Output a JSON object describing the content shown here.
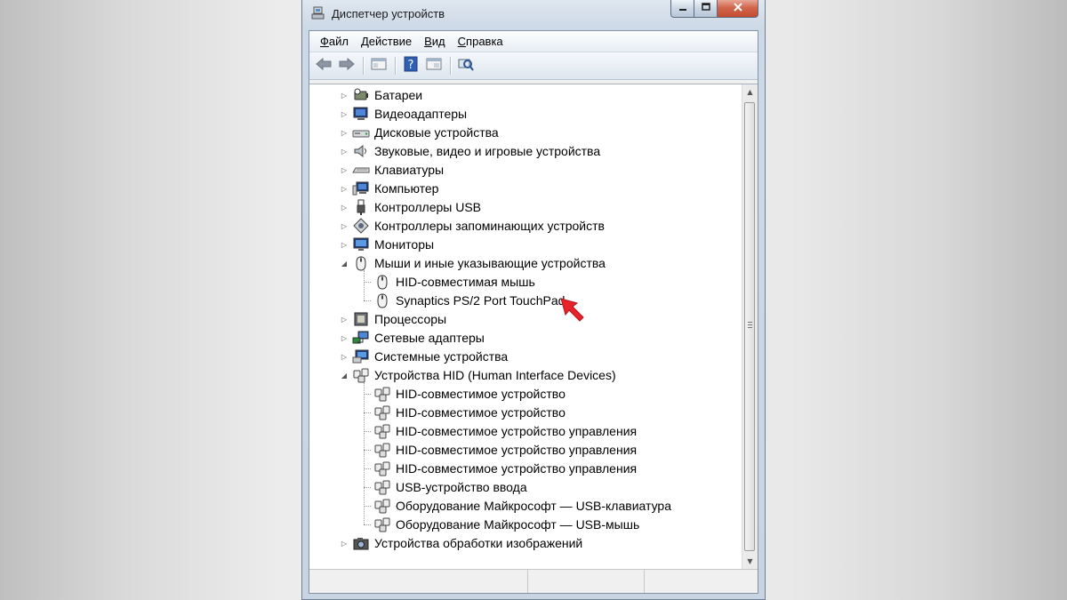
{
  "window": {
    "title": "Диспетчер устройств",
    "title_icon": "device-manager-icon",
    "controls": [
      "minimize-icon",
      "maximize-icon",
      "close-icon"
    ]
  },
  "menu": [
    {
      "label_underlined": "Ф",
      "label_rest": "айл"
    },
    {
      "label_underlined": "Д",
      "label_rest": "ействие"
    },
    {
      "label_underlined": "В",
      "label_rest": "ид"
    },
    {
      "label_underlined": "С",
      "label_rest": "правка"
    }
  ],
  "toolbar": {
    "icons": [
      "back-arrow-icon",
      "forward-arrow-icon",
      "properties-icon",
      "help-icon",
      "view-icon",
      "scan-hardware-icon"
    ]
  },
  "tree": {
    "categories": [
      {
        "label": "Батареи",
        "icon": "battery-icon",
        "expanded": false
      },
      {
        "label": "Видеоадаптеры",
        "icon": "display-adapter-icon",
        "expanded": false
      },
      {
        "label": "Дисковые устройства",
        "icon": "disk-drive-icon",
        "expanded": false
      },
      {
        "label": "Звуковые, видео и игровые устройства",
        "icon": "speaker-icon",
        "expanded": false
      },
      {
        "label": "Клавиатуры",
        "icon": "keyboard-icon",
        "expanded": false
      },
      {
        "label": "Компьютер",
        "icon": "computer-icon",
        "expanded": false
      },
      {
        "label": "Контроллеры USB",
        "icon": "usb-icon",
        "expanded": false
      },
      {
        "label": "Контроллеры запоминающих устройств",
        "icon": "storage-controller-icon",
        "expanded": false
      },
      {
        "label": "Мониторы",
        "icon": "monitor-icon",
        "expanded": false
      },
      {
        "label": "Мыши и иные указывающие устройства",
        "icon": "mouse-icon",
        "expanded": true,
        "children": [
          {
            "label": "HID-совместимая мышь",
            "icon": "mouse-icon"
          },
          {
            "label": "Synaptics PS/2 Port TouchPad",
            "icon": "mouse-icon"
          }
        ]
      },
      {
        "label": "Процессоры",
        "icon": "processor-icon",
        "expanded": false
      },
      {
        "label": "Сетевые адаптеры",
        "icon": "network-adapter-icon",
        "expanded": false
      },
      {
        "label": "Системные устройства",
        "icon": "system-device-icon",
        "expanded": false
      },
      {
        "label": "Устройства HID (Human Interface Devices)",
        "icon": "hid-device-icon",
        "expanded": true,
        "children": [
          {
            "label": "HID-совместимое устройство",
            "icon": "hid-device-icon"
          },
          {
            "label": "HID-совместимое устройство",
            "icon": "hid-device-icon"
          },
          {
            "label": "HID-совместимое устройство управления",
            "icon": "hid-device-icon"
          },
          {
            "label": "HID-совместимое устройство управления",
            "icon": "hid-device-icon"
          },
          {
            "label": "HID-совместимое устройство управления",
            "icon": "hid-device-icon"
          },
          {
            "label": "USB-устройство ввода",
            "icon": "hid-device-icon"
          },
          {
            "label": "Оборудование Майкрософт — USB-клавиатура",
            "icon": "hid-device-icon"
          },
          {
            "label": "Оборудование Майкрософт — USB-мышь",
            "icon": "hid-device-icon"
          }
        ]
      },
      {
        "label": "Устройства обработки изображений",
        "icon": "camera-icon",
        "expanded": false
      }
    ]
  },
  "annotation": {
    "icon": "red-pointer-arrow-icon",
    "color": "#e8222a"
  },
  "colors": {
    "title_bar": "#cdd9e6",
    "close_button": "#c94f33",
    "tree_background": "#ffffff"
  }
}
